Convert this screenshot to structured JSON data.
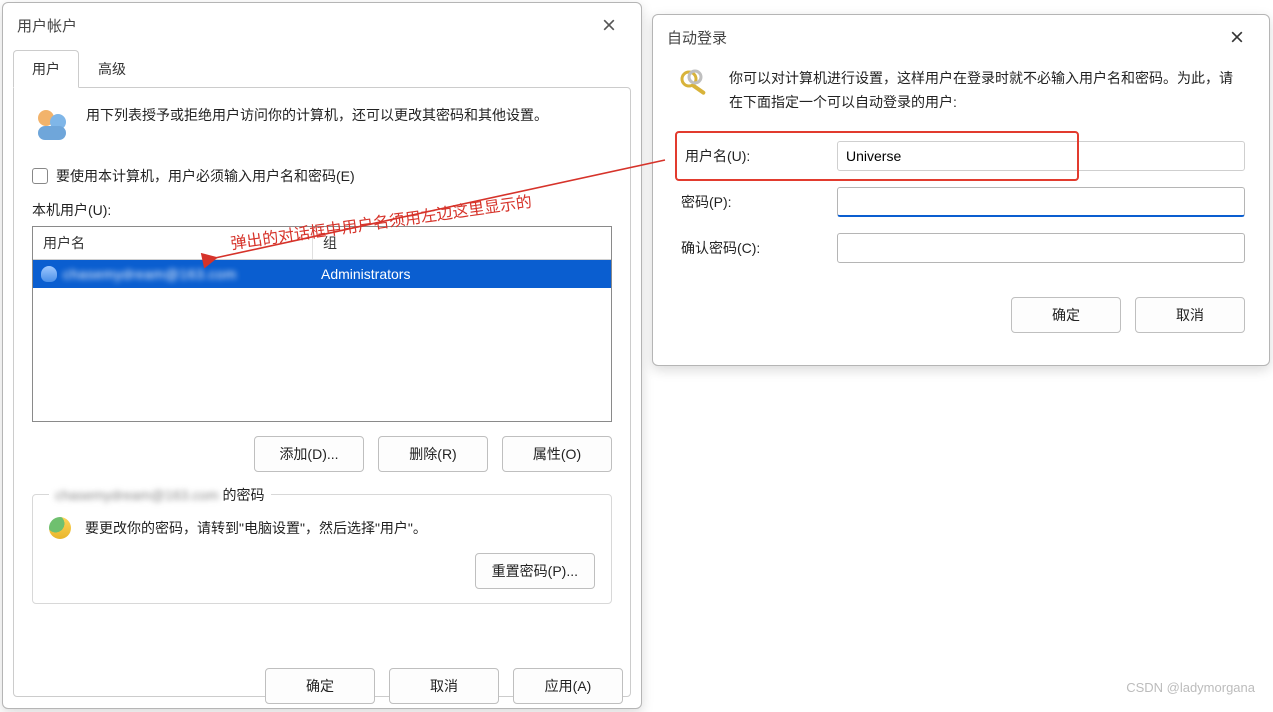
{
  "win1": {
    "title": "用户帐户",
    "tabs": {
      "users": "用户",
      "advanced": "高级"
    },
    "intro": "用下列表授予或拒绝用户访问你的计算机，还可以更改其密码和其他设置。",
    "require_login_label": "要使用本计算机，用户必须输入用户名和密码(E)",
    "local_users_label": "本机用户(U):",
    "columns": {
      "user": "用户名",
      "group": "组"
    },
    "row": {
      "user_blurred": "chasemydream@163.com",
      "group": "Administrators"
    },
    "buttons": {
      "add": "添加(D)...",
      "remove": "删除(R)",
      "props": "属性(O)"
    },
    "pw_group_legend_blurred": "chasemydream@163.com",
    "pw_group_suffix": " 的密码",
    "pw_hint": "要更改你的密码，请转到\"电脑设置\"，然后选择\"用户\"。",
    "reset_pw": "重置密码(P)...",
    "footer": {
      "ok": "确定",
      "cancel": "取消",
      "apply": "应用(A)"
    }
  },
  "win2": {
    "title": "自动登录",
    "intro": "你可以对计算机进行设置，这样用户在登录时就不必输入用户名和密码。为此，请在下面指定一个可以自动登录的用户:",
    "fields": {
      "username_label": "用户名(U):",
      "username_value": "Universe",
      "password_label": "密码(P):",
      "confirm_label": "确认密码(C):"
    },
    "buttons": {
      "ok": "确定",
      "cancel": "取消"
    }
  },
  "annotation": "弹出的对话框中用户名须用左边这里显示的",
  "watermark": "CSDN @ladymorgana"
}
